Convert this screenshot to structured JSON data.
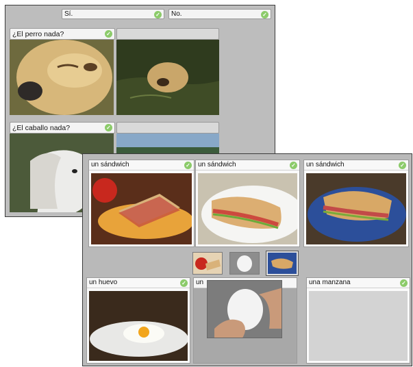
{
  "back_window": {
    "answers": [
      {
        "label": "Sí."
      },
      {
        "label": "No."
      }
    ],
    "questions": [
      {
        "prompt": "¿El perro nada?"
      },
      {
        "prompt": "¿El caballo nada?"
      }
    ]
  },
  "front_window": {
    "cards": [
      {
        "label": "un sándwich"
      },
      {
        "label": "un sándwich"
      },
      {
        "label": "un sándwich"
      },
      {
        "label": "un huevo"
      },
      {
        "label": "un"
      },
      {
        "label": "una manzana"
      }
    ]
  },
  "icons": {
    "check": "check-icon"
  },
  "colors": {
    "check": "#8ccb6a",
    "window_bg": "#bdbdbd"
  }
}
